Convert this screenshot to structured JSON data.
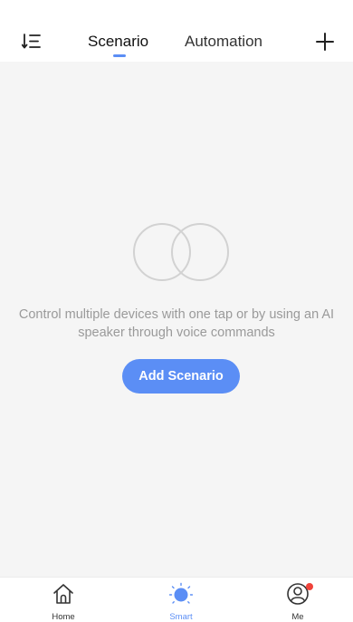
{
  "header": {
    "tabs": [
      {
        "label": "Scenario",
        "active": true
      },
      {
        "label": "Automation",
        "active": false
      }
    ],
    "sort_icon": "sort-list-icon",
    "add_icon": "plus-icon"
  },
  "empty_state": {
    "illustration_icon": "overlapping-circles-icon",
    "message": "Control multiple devices with one tap or by using an AI speaker through voice commands",
    "button_label": "Add Scenario"
  },
  "bottom_nav": {
    "items": [
      {
        "label": "Home",
        "icon": "home-icon",
        "active": false
      },
      {
        "label": "Smart",
        "icon": "sun-icon",
        "active": true
      },
      {
        "label": "Me",
        "icon": "profile-icon",
        "active": false,
        "badge": true
      }
    ]
  },
  "colors": {
    "accent": "#5b8ef5",
    "background": "#f5f5f5",
    "badge": "#f0433a",
    "muted_text": "#9a9a9a"
  }
}
